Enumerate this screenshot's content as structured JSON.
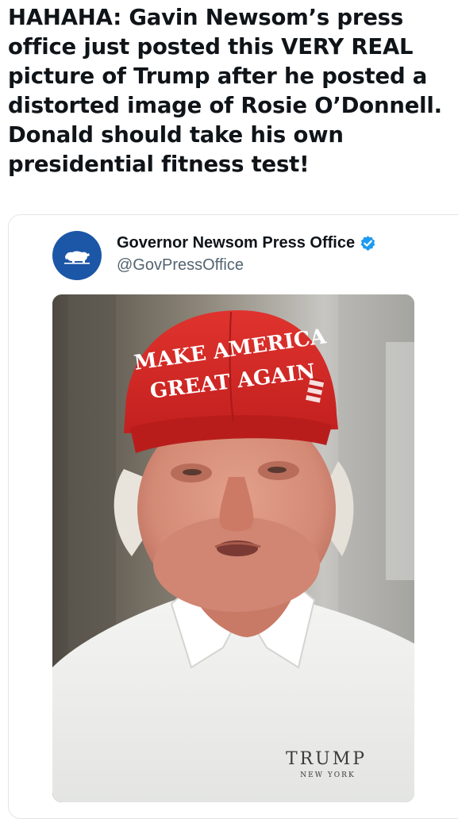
{
  "post": {
    "text": "HAHAHA: Gavin Newsom’s press office just posted this VERY REAL picture of Trump after he posted a distorted image of Rosie O’Donnell. Donald should take his own presidential fitness test!"
  },
  "quoted_post": {
    "author_name": "Governor Newsom Press Office",
    "author_handle": "@GovPressOffice",
    "verified": true,
    "avatar_icon": "california-bear-icon",
    "avatar_color": "#1c56a6",
    "verified_color": "#1d9bf0",
    "image": {
      "hat_line_1": "MAKE AMERICA",
      "hat_line_2": "GREAT AGAIN",
      "shirt_logo": "TRUMP",
      "shirt_logo_sub": "NEW YORK"
    }
  }
}
